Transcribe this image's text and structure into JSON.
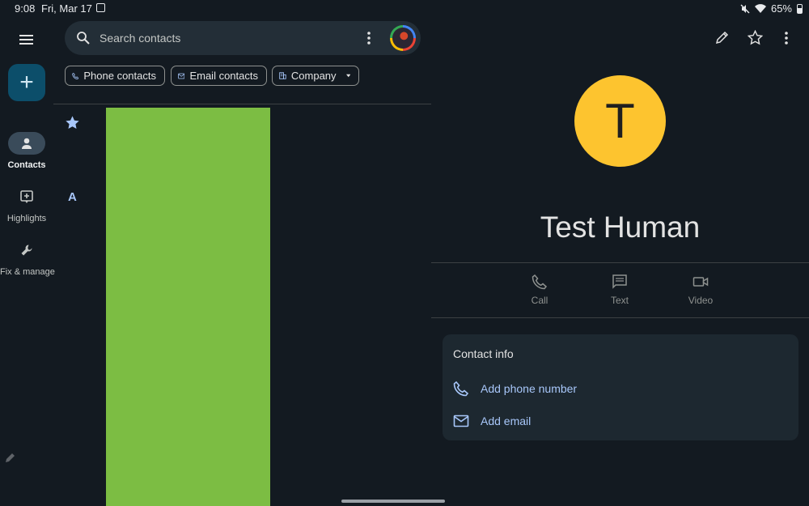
{
  "status_bar": {
    "time": "9:08",
    "date": "Fri, Mar 17",
    "battery": "65%",
    "icons": [
      "mute-icon",
      "wifi-icon",
      "battery-icon"
    ]
  },
  "nav": {
    "items": [
      {
        "label": "Contacts",
        "icon": "person-icon",
        "active": true
      },
      {
        "label": "Highlights",
        "icon": "highlights-icon",
        "active": false
      },
      {
        "label": "Fix & manage",
        "icon": "wrench-icon",
        "active": false
      }
    ]
  },
  "search": {
    "placeholder": "Search contacts"
  },
  "filters": {
    "phone_label": "Phone contacts",
    "email_label": "Email contacts",
    "company_label": "Company"
  },
  "list": {
    "section_letter": "A"
  },
  "contact": {
    "initial": "T",
    "name": "Test Human",
    "avatar_color": "#fdc42f",
    "actions": {
      "call": "Call",
      "text": "Text",
      "video": "Video"
    },
    "info": {
      "title": "Contact info",
      "add_phone": "Add phone number",
      "add_email": "Add email"
    }
  },
  "colors": {
    "background": "#131a21",
    "accent": "#a8c7fa",
    "fab": "#0c4e6a",
    "green_block": "#7cbd43"
  }
}
